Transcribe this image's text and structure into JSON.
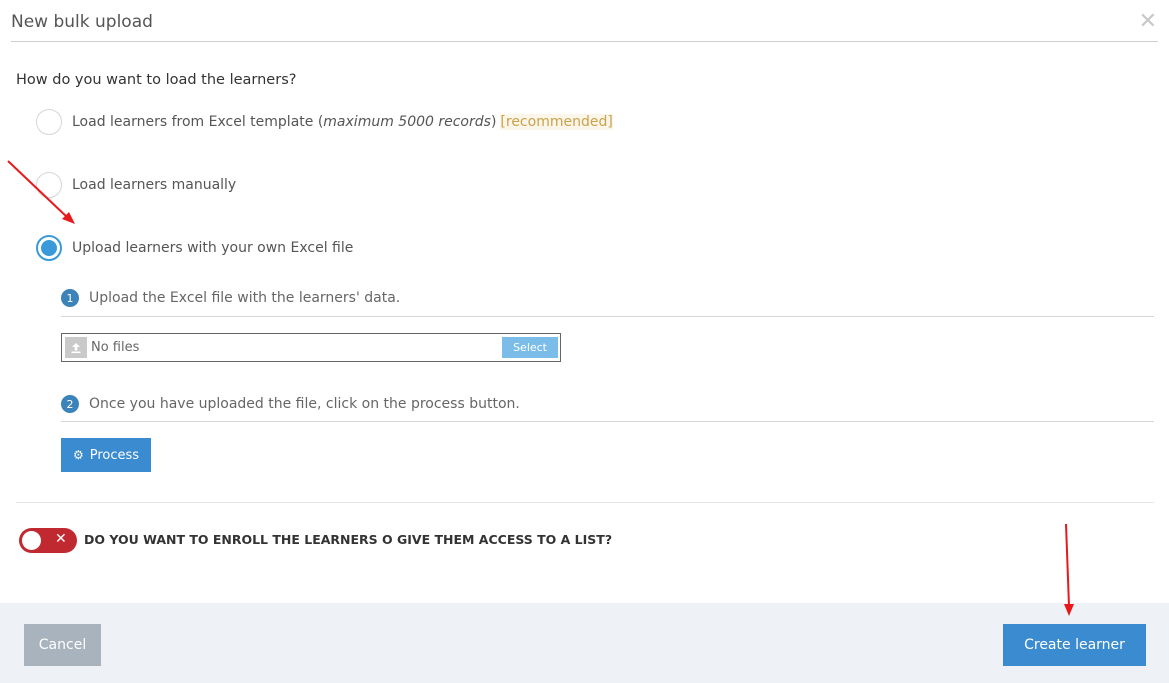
{
  "dialog": {
    "title": "New bulk upload",
    "close_icon": "close-icon",
    "question": "How do you want to load the learners?"
  },
  "options": {
    "excel_template": {
      "label_start": "Load learners from Excel template (",
      "label_italic": "maximum 5000 records",
      "label_end": ")",
      "badge": "[recommended]",
      "selected": false
    },
    "manual": {
      "label": "Load learners manually",
      "selected": false
    },
    "own_file": {
      "label": "Upload learners with your own Excel file",
      "selected": true
    }
  },
  "steps": {
    "one": {
      "number": "1",
      "text": "Upload the Excel file with the learners' data."
    },
    "two": {
      "number": "2",
      "text": "Once you have uploaded the file, click on the process button."
    }
  },
  "file_picker": {
    "icon": "upload-icon",
    "text": "No files",
    "button_label": "Select"
  },
  "process_button": {
    "icon": "gear-icon",
    "label": "Process"
  },
  "enroll_toggle": {
    "state": "off",
    "label": "DO YOU WANT TO ENROLL THE LEARNERS O GIVE THEM ACCESS TO A LIST?"
  },
  "footer": {
    "cancel_label": "Cancel",
    "create_label": "Create learner"
  },
  "colors": {
    "accent": "#3b8bd1",
    "radio_selected": "#3a9ad9",
    "toggle_off": "#c0292f",
    "recommended": "#c9a24b",
    "annotation_arrow": "#e8191c"
  }
}
